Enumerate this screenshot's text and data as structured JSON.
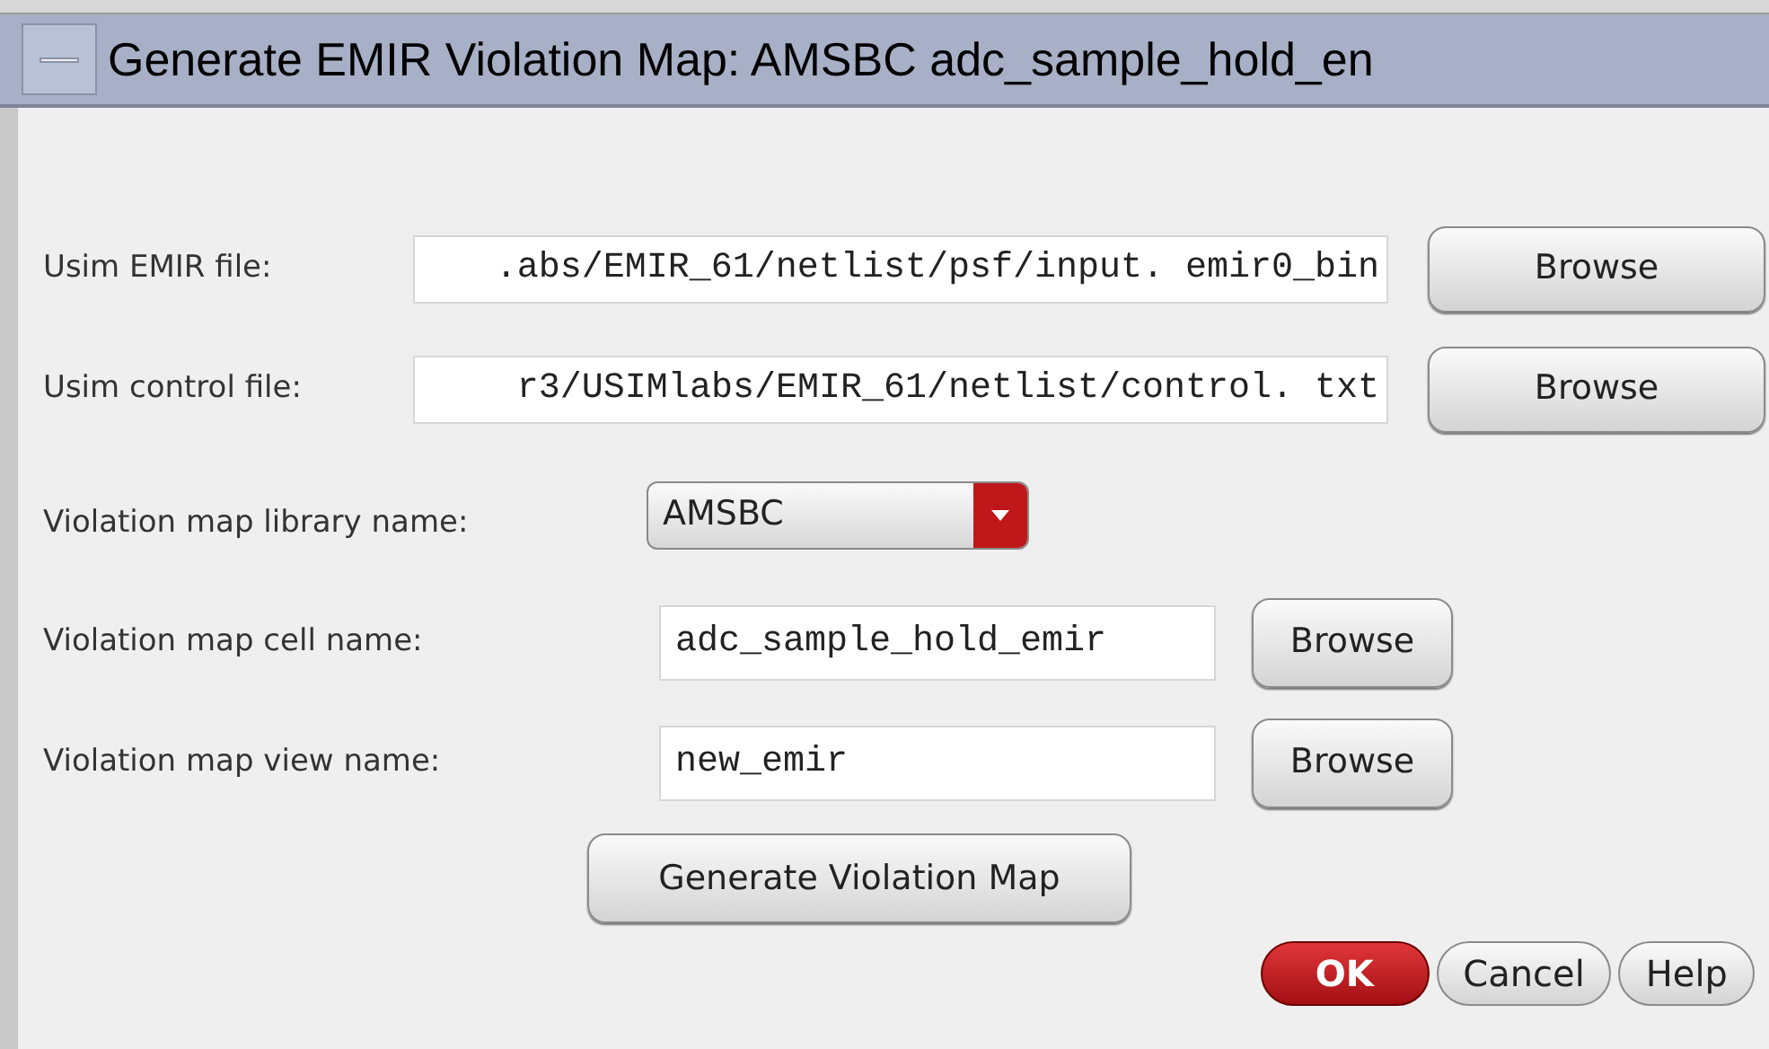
{
  "window": {
    "title": "Generate EMIR Violation Map: AMSBC adc_sample_hold_en"
  },
  "fields": [
    {
      "kind": "file",
      "label": "Usim EMIR file:",
      "value": ".abs/EMIR_61/netlist/psf/input. emir0_bin",
      "button": "Browse"
    },
    {
      "kind": "file",
      "label": "Usim control file:",
      "value": "r3/USIMlabs/EMIR_61/netlist/control. txt",
      "button": "Browse"
    },
    {
      "kind": "dropdown",
      "label": "Violation map library name:",
      "value": "AMSBC"
    },
    {
      "kind": "text",
      "label": "Violation map cell name:",
      "value": "adc_sample_hold_emir",
      "button": "Browse"
    },
    {
      "kind": "text",
      "label": "Violation map view name:",
      "value": "new_emir",
      "button": "Browse"
    }
  ],
  "generate_button": "Generate Violation Map",
  "buttons": [
    {
      "label": "OK",
      "default": true
    },
    {
      "label": "Cancel",
      "default": false
    },
    {
      "label": "Help",
      "default": false
    }
  ]
}
